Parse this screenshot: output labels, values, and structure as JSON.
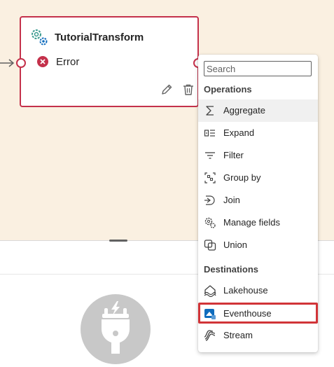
{
  "node": {
    "title": "TutorialTransform",
    "status": "Error"
  },
  "menu": {
    "search_placeholder": "Search",
    "operations_title": "Operations",
    "operations": [
      {
        "label": "Aggregate",
        "icon": "sigma-icon"
      },
      {
        "label": "Expand",
        "icon": "expand-icon"
      },
      {
        "label": "Filter",
        "icon": "filter-icon"
      },
      {
        "label": "Group by",
        "icon": "group-by-icon"
      },
      {
        "label": "Join",
        "icon": "join-icon"
      },
      {
        "label": "Manage fields",
        "icon": "gears-icon"
      },
      {
        "label": "Union",
        "icon": "union-icon"
      }
    ],
    "destinations_title": "Destinations",
    "destinations": [
      {
        "label": "Lakehouse",
        "icon": "lakehouse-icon"
      },
      {
        "label": "Eventhouse",
        "icon": "eventhouse-icon"
      },
      {
        "label": "Stream",
        "icon": "stream-icon"
      }
    ]
  },
  "colors": {
    "canvas": "#faf0e1",
    "error": "#c4314b",
    "highlight": "#d13438",
    "accent": "#0f6cbd"
  }
}
